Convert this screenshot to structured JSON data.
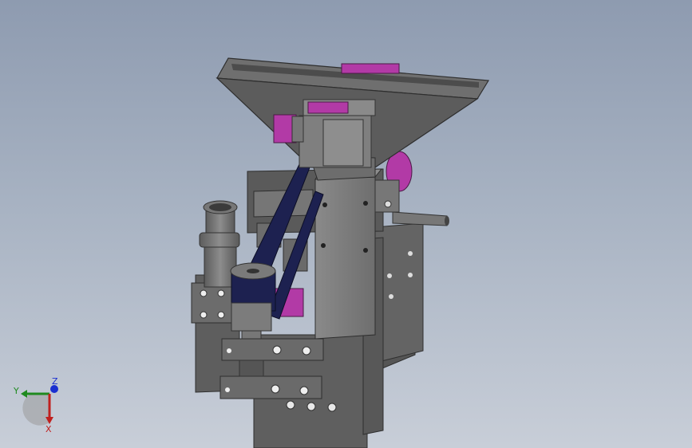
{
  "viewport": {
    "background_top": "#8e9bb0",
    "background_bottom": "#c8ced8"
  },
  "model": {
    "body_color": "#6a6a6a",
    "dark_color": "#3e3e3e",
    "accent_color": "#b23aa6",
    "belt_color": "#1d2150"
  },
  "triad": {
    "x_label": "X",
    "y_label": "Y",
    "z_label": "Z",
    "x_color": "#c0201e",
    "y_color": "#1f8a1f",
    "z_color": "#1a2fd0"
  }
}
